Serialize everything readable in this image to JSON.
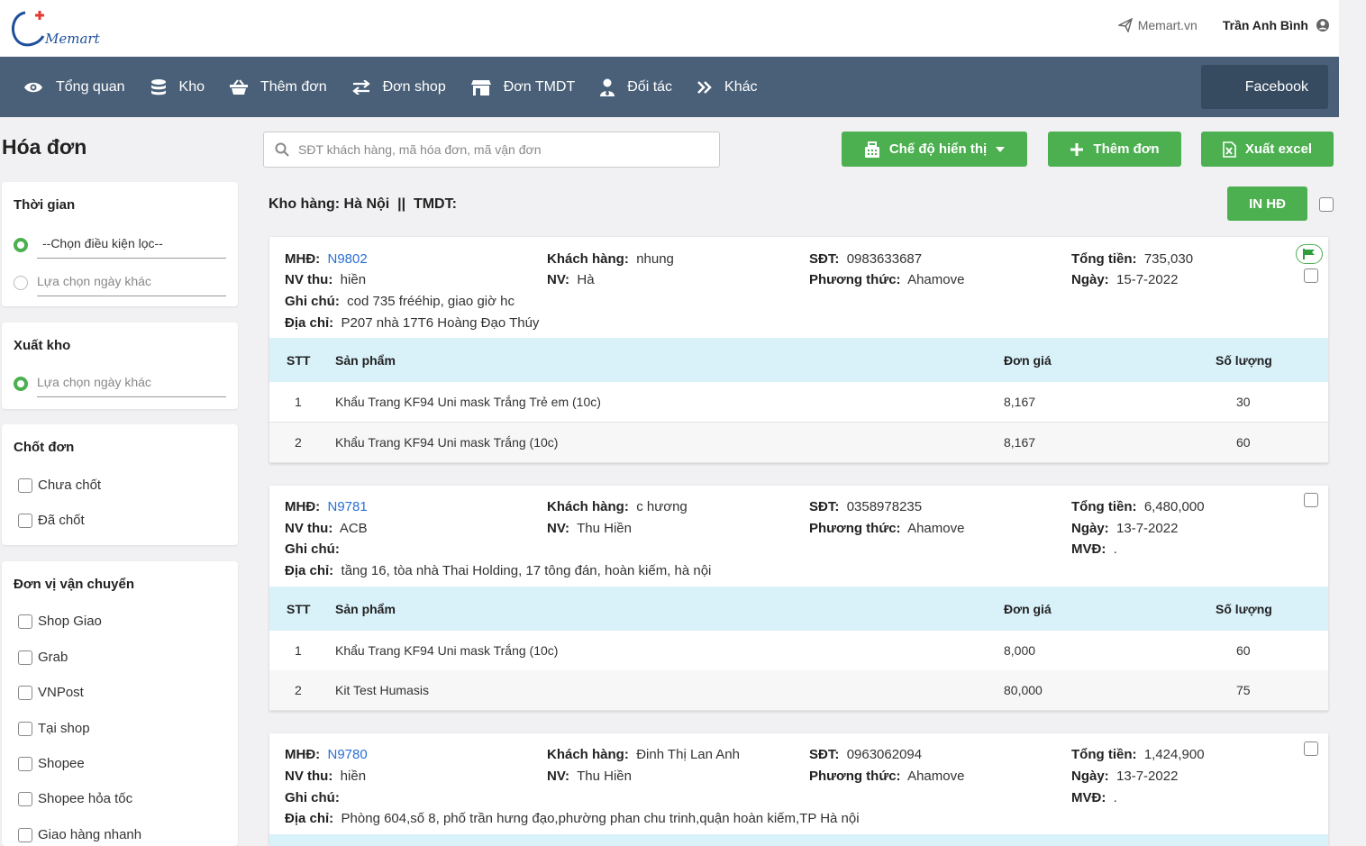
{
  "header": {
    "site_link": "Memart.vn",
    "user_name": "Trần Anh Bình",
    "logo_text": "Memart"
  },
  "nav": [
    {
      "label": "Tổng quan",
      "icon": "eye-icon"
    },
    {
      "label": "Kho",
      "icon": "database-icon"
    },
    {
      "label": "Thêm đơn",
      "icon": "basket-icon"
    },
    {
      "label": "Đơn shop",
      "icon": "exchange-icon"
    },
    {
      "label": "Đơn TMDT",
      "icon": "store-icon"
    },
    {
      "label": "Đối tác",
      "icon": "user-tie-icon"
    },
    {
      "label": "Khác",
      "icon": "double-chevron-icon"
    }
  ],
  "facebook_label": "Facebook",
  "page_title": "Hóa đơn",
  "search": {
    "placeholder": "SĐT khách hàng, mã hóa đơn, mã vận đơn"
  },
  "buttons": {
    "display_mode": "Chế độ hiển thị",
    "add_order": "Thêm đơn",
    "export_excel": "Xuất excel",
    "print": "IN HĐ"
  },
  "kho_line": "Kho hàng: Hà Nội  ||  TMDT:",
  "filters": {
    "time": {
      "title": "Thời gian",
      "option1": "--Chọn điều kiện lọc--",
      "option2": "Lựa chọn ngày khác"
    },
    "export": {
      "title": "Xuất kho",
      "option1": "Lựa chọn ngày khác"
    },
    "close": {
      "title": "Chốt đơn",
      "opt1": "Chưa chốt",
      "opt2": "Đã chốt"
    },
    "shipping": {
      "title": "Đơn vị vận chuyển",
      "opts": [
        "Shop Giao",
        "Grab",
        "VNPost",
        "Tại shop",
        "Shopee",
        "Shopee hỏa tốc",
        "Giao hàng nhanh"
      ]
    }
  },
  "labels": {
    "mhd": "MHĐ:",
    "customer": "Khách hàng:",
    "phone": "SĐT:",
    "total": "Tổng tiền:",
    "nv_thu": "NV thu:",
    "nv": "NV:",
    "method": "Phương thức:",
    "date": "Ngày:",
    "note": "Ghi chú:",
    "address": "Địa chỉ:",
    "mvd": "MVĐ:",
    "col_stt": "STT",
    "col_product": "Sản phẩm",
    "col_price": "Đơn giá",
    "col_qty": "Số lượng"
  },
  "orders": [
    {
      "id": "N9802",
      "customer": "nhung",
      "phone": "0983633687",
      "total": "735,030",
      "nv_thu": "hiền",
      "nv": "Hà",
      "method": "Ahamove",
      "date": "15-7-2022",
      "note": "cod 735 frééhip, giao giờ hc",
      "address": "P207 nhà 17T6 Hoàng Đạo Thúy",
      "items": [
        {
          "stt": "1",
          "product": "Khẩu Trang KF94 Uni mask Trắng Trẻ em (10c)",
          "price": "8,167",
          "qty": "30"
        },
        {
          "stt": "2",
          "product": "Khẩu Trang KF94 Uni mask Trắng (10c)",
          "price": "8,167",
          "qty": "60"
        }
      ]
    },
    {
      "id": "N9781",
      "customer": "c hương",
      "phone": "0358978235",
      "total": "6,480,000",
      "nv_thu": "ACB",
      "nv": "Thu Hiền",
      "method": "Ahamove",
      "date": "13-7-2022",
      "mvd": ".",
      "note": "",
      "address": "tầng 16, tòa nhà Thai Holding, 17 tông đán, hoàn kiếm, hà nội",
      "items": [
        {
          "stt": "1",
          "product": "Khẩu Trang KF94 Uni mask Trắng (10c)",
          "price": "8,000",
          "qty": "60"
        },
        {
          "stt": "2",
          "product": "Kit Test Humasis",
          "price": "80,000",
          "qty": "75"
        }
      ]
    },
    {
      "id": "N9780",
      "customer": "Đinh Thị Lan Anh",
      "phone": "0963062094",
      "total": "1,424,900",
      "nv_thu": "hiền",
      "nv": "Thu Hiền",
      "method": "Ahamove",
      "date": "13-7-2022",
      "mvd": ".",
      "note": "",
      "address": "Phòng 604,số 8, phố trần hưng đạo,phường phan chu trinh,quận hoàn kiếm,TP Hà nội"
    }
  ],
  "colors": {
    "nav_bg": "#4a6078",
    "accent_green": "#4caf50",
    "table_head": "#d9f2fa",
    "link_blue": "#2a6fd6"
  }
}
